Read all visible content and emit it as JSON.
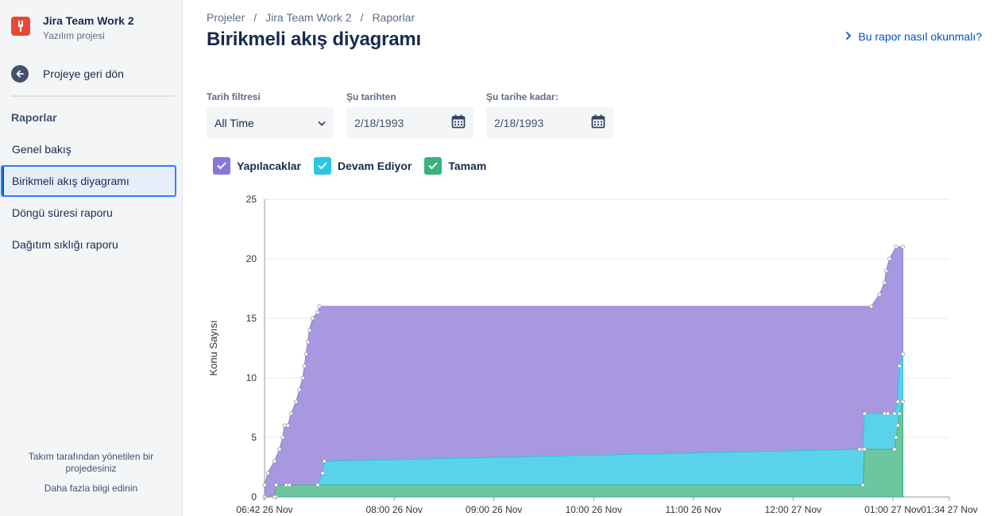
{
  "project": {
    "name": "Jira Team Work 2",
    "type": "Yazılım projesi"
  },
  "sidebar": {
    "back_label": "Projeye geri dön",
    "section_title": "Raporlar",
    "items": [
      {
        "label": "Genel bakış"
      },
      {
        "label": "Birikmeli akış diyagramı",
        "active": true
      },
      {
        "label": "Döngü süresi raporu"
      },
      {
        "label": "Dağıtım sıklığı raporu"
      }
    ],
    "footer_note": "Takım tarafından yönetilen bir projedesiniz",
    "footer_link": "Daha fazla bilgi edinin"
  },
  "breadcrumb": [
    "Projeler",
    "Jira Team Work 2",
    "Raporlar"
  ],
  "page_title": "Birikmeli akış diyagramı",
  "help_link": "Bu rapor nasıl okunmalı?",
  "filters": {
    "date_filter": {
      "label": "Tarih filtresi",
      "value": "All Time"
    },
    "from": {
      "label": "Şu tarihten",
      "value": "2/18/1993"
    },
    "to": {
      "label": "Şu tarihe kadar:",
      "value": "2/18/1993"
    }
  },
  "legend": [
    {
      "label": "Yapılacaklar",
      "color": "#8777D9",
      "checked": true
    },
    {
      "label": "Devam Ediyor",
      "color": "#2AC6E3",
      "checked": true
    },
    {
      "label": "Tamam",
      "color": "#36B37E",
      "checked": true
    }
  ],
  "chart_data": {
    "type": "area",
    "ylabel": "Konu Sayısı",
    "ylim": [
      0,
      25
    ],
    "yticks": [
      0,
      5,
      10,
      15,
      20,
      25
    ],
    "xlim": [
      "2019-11-26 06:42",
      "2019-11-27 01:34"
    ],
    "xticks": [
      {
        "t": "06:42",
        "label": "06:42 26 Nov"
      },
      {
        "t": "08:00",
        "label": "08:00 26 Nov"
      },
      {
        "t": "09:00",
        "label": "09:00 26 Nov"
      },
      {
        "t": "10:00",
        "label": "10:00 26 Nov"
      },
      {
        "t": "11:00",
        "label": "11:00 26 Nov"
      },
      {
        "t": "12:00",
        "label": "12:00 27 Nov"
      },
      {
        "t": "13:00",
        "label": "01:00 27 Nov"
      },
      {
        "t": "13:34",
        "label": "01:34 27 Nov"
      }
    ],
    "grid": true,
    "series": [
      {
        "name": "Yapılacaklar",
        "points": [
          [
            "06:42",
            1
          ],
          [
            "06:44",
            2
          ],
          [
            "06:48",
            3
          ],
          [
            "06:51",
            4
          ],
          [
            "06:53",
            5
          ],
          [
            "06:54",
            6
          ],
          [
            "06:56",
            6
          ],
          [
            "06:58",
            7
          ],
          [
            "07:01",
            8
          ],
          [
            "07:03",
            9
          ],
          [
            "07:05",
            10
          ],
          [
            "07:06",
            11
          ],
          [
            "07:07",
            12
          ],
          [
            "07:08",
            13
          ],
          [
            "07:09",
            14
          ],
          [
            "07:11",
            15
          ],
          [
            "07:14",
            15.5
          ],
          [
            "07:15",
            16
          ],
          [
            "12:47",
            16
          ],
          [
            "12:52",
            17
          ],
          [
            "12:55",
            18
          ],
          [
            "12:56",
            19
          ],
          [
            "12:58",
            20
          ],
          [
            "13:02",
            21
          ],
          [
            "13:06",
            21
          ]
        ]
      },
      {
        "name": "Devam Ediyor",
        "points": [
          [
            "06:42",
            0
          ],
          [
            "06:49",
            0
          ],
          [
            "06:55",
            1
          ],
          [
            "06:57",
            1
          ],
          [
            "07:14",
            1
          ],
          [
            "07:17",
            2
          ],
          [
            "07:18",
            3
          ],
          [
            "12:40",
            4
          ],
          [
            "12:42",
            4
          ],
          [
            "12:43",
            7
          ],
          [
            "12:55",
            7
          ],
          [
            "12:57",
            7
          ],
          [
            "13:01",
            7
          ],
          [
            "13:03",
            8
          ],
          [
            "13:04",
            11
          ],
          [
            "13:06",
            12
          ]
        ]
      },
      {
        "name": "Tamam",
        "points": [
          [
            "06:42",
            0
          ],
          [
            "06:48",
            0
          ],
          [
            "06:49",
            1
          ],
          [
            "12:42",
            1
          ],
          [
            "12:43",
            4
          ],
          [
            "13:01",
            4
          ],
          [
            "13:02",
            5
          ],
          [
            "13:03",
            6
          ],
          [
            "13:04",
            7
          ],
          [
            "13:06",
            8
          ]
        ]
      }
    ]
  }
}
